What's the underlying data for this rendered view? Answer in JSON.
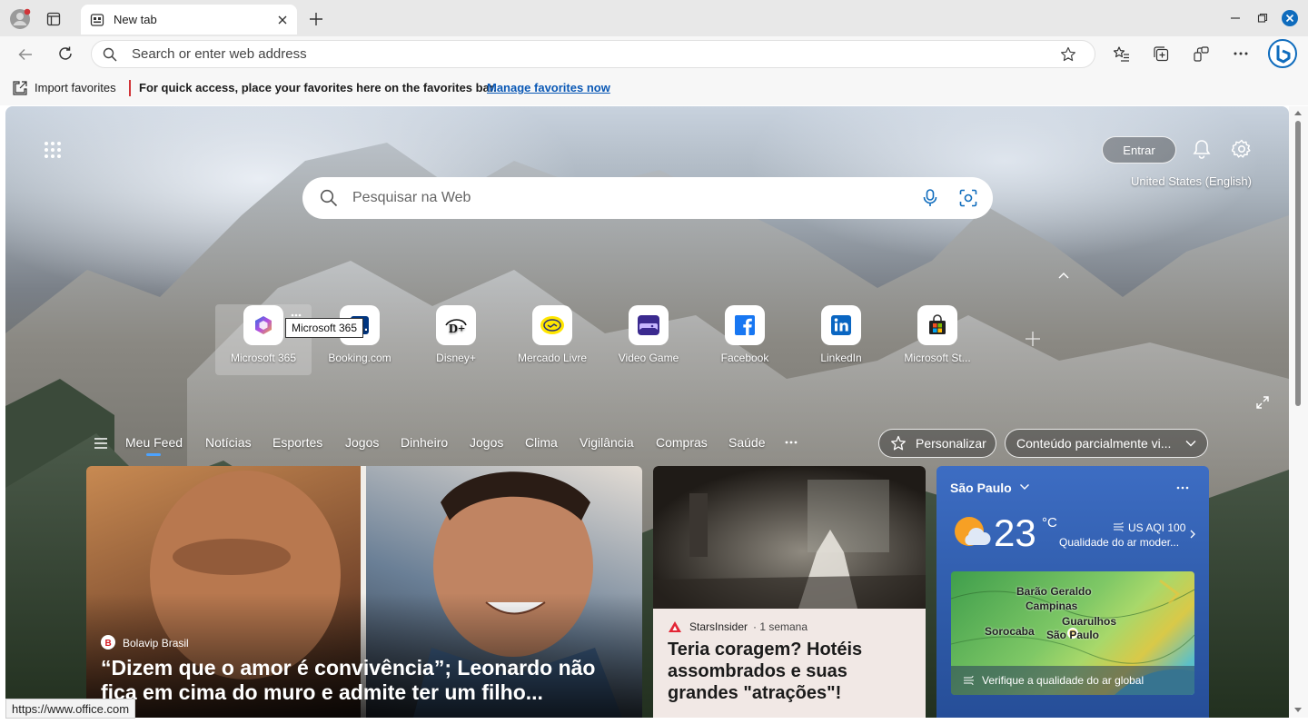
{
  "browser": {
    "tab_title": "New tab",
    "address_placeholder": "Search or enter web address",
    "favorites": {
      "import_label": "Import favorites",
      "message": "For quick access, place your favorites here on the favorites bar.",
      "manage_link": "Manage favorites now"
    },
    "status_url": "https://www.office.com"
  },
  "newtab": {
    "signin_label": "Entrar",
    "region_label": "United States (English)",
    "search_placeholder": "Pesquisar na Web",
    "tooltip": "Microsoft 365",
    "quick_links": [
      {
        "label": "Microsoft 365",
        "icon": "microsoft-365-icon"
      },
      {
        "label": "Booking.com",
        "icon": "booking-icon"
      },
      {
        "label": "Disney+",
        "icon": "disney-plus-icon"
      },
      {
        "label": "Mercado Livre",
        "icon": "mercado-livre-icon"
      },
      {
        "label": "Video Game",
        "icon": "gamepad-icon"
      },
      {
        "label": "Facebook",
        "icon": "facebook-icon"
      },
      {
        "label": "LinkedIn",
        "icon": "linkedin-icon"
      },
      {
        "label": "Microsoft St...",
        "icon": "microsoft-store-icon"
      }
    ],
    "feed_nav": [
      "Meu Feed",
      "Notícias",
      "Esportes",
      "Jogos",
      "Dinheiro",
      "Jogos",
      "Clima",
      "Vigilância",
      "Compras",
      "Saúde"
    ],
    "personalize_label": "Personalizar",
    "content_select_label": "Conteúdo parcialmente vi...",
    "main_card": {
      "source": "Bolavip Brasil",
      "headline": "“Dizem que o amor é convivência”; Leonardo não fica em cima do muro e admite ter um filho..."
    },
    "side_card": {
      "source": "StarsInsider",
      "age": "· 1 semana",
      "headline": "Teria coragem? Hotéis assombrados e suas grandes \"atrações\"!"
    },
    "weather": {
      "city": "São Paulo",
      "temp": "23",
      "unit": "°C",
      "aqi": "US AQI 100",
      "aqi_desc": "Qualidade do ar moder...",
      "map_labels": [
        "Barão Geraldo",
        "Campinas",
        "Sorocaba",
        "Guarulhos",
        "São Paulo"
      ],
      "map_footer": "Verifique a qualidade do ar global"
    }
  },
  "colors": {
    "accent": "#0f6cbd",
    "link": "#0a58b5"
  }
}
